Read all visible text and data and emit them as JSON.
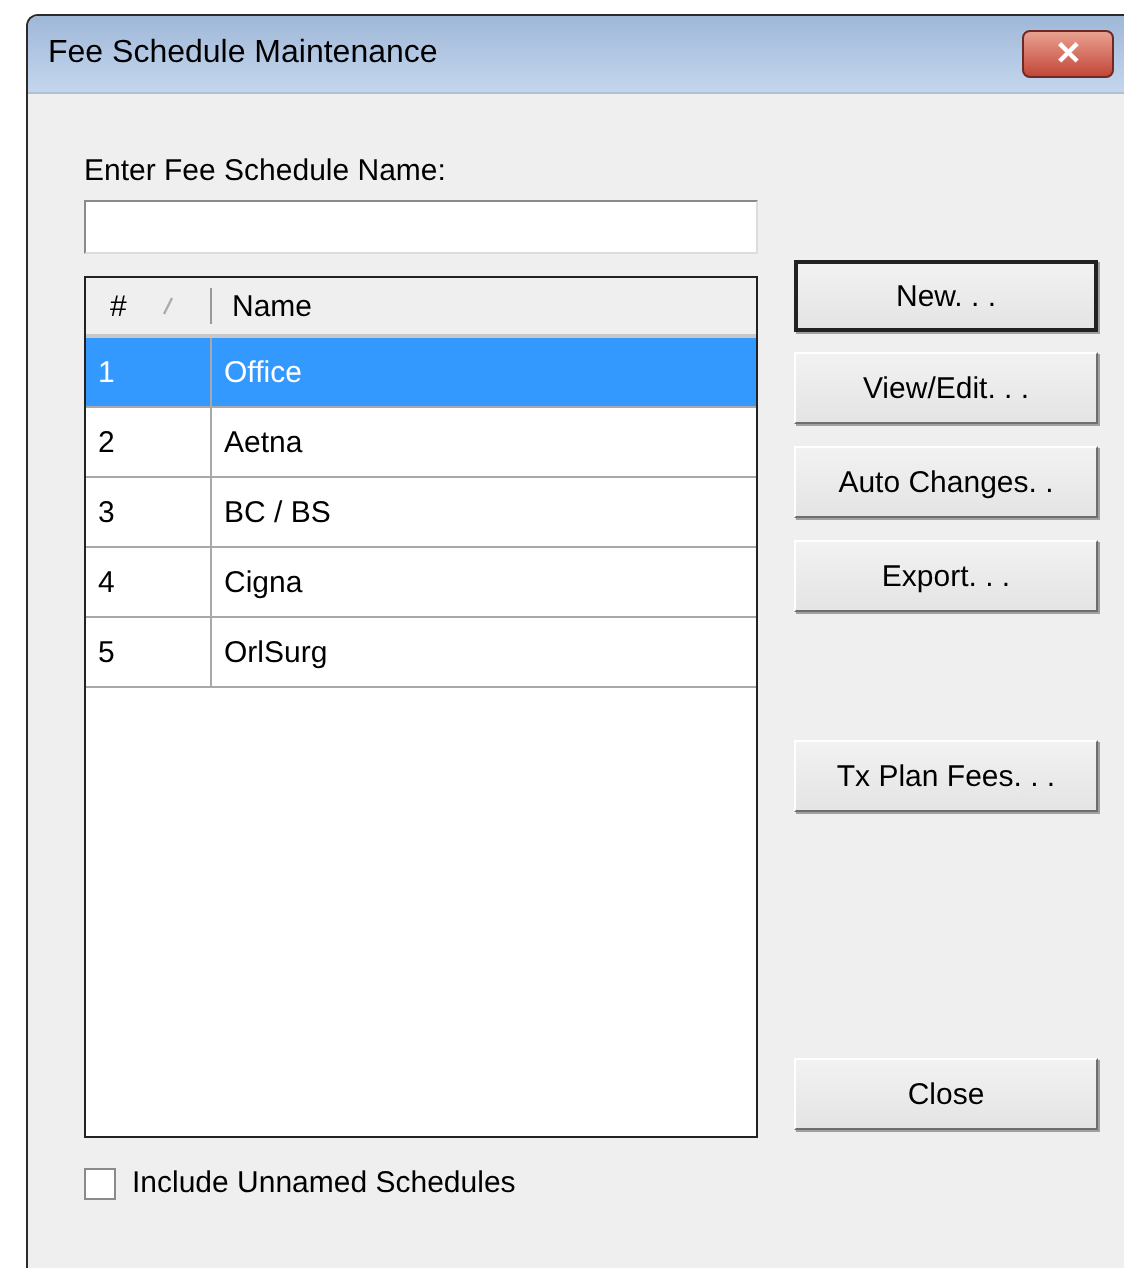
{
  "window": {
    "title": "Fee Schedule Maintenance",
    "close_glyph": "✕"
  },
  "name_field": {
    "label": "Enter Fee Schedule Name:"
  },
  "table": {
    "columns": [
      "#",
      "Name"
    ],
    "rows": [
      {
        "number": "1",
        "name": "Office",
        "selected": true
      },
      {
        "number": "2",
        "name": "Aetna",
        "selected": false
      },
      {
        "number": "3",
        "name": "BC / BS",
        "selected": false
      },
      {
        "number": "4",
        "name": "Cigna",
        "selected": false
      },
      {
        "number": "5",
        "name": "OrlSurg",
        "selected": false
      }
    ]
  },
  "buttons": [
    {
      "label": "New. . .",
      "default": true
    },
    {
      "label": "View/Edit. . .",
      "default": false
    },
    {
      "label": "Auto Changes. .",
      "default": false
    },
    {
      "label": "Export. . .",
      "default": false
    },
    {
      "label": "Tx Plan Fees. . .",
      "default": false
    },
    {
      "label": "Close",
      "default": false
    }
  ],
  "include_unnamed": {
    "label": "Include Unnamed Schedules",
    "checked": false
  }
}
